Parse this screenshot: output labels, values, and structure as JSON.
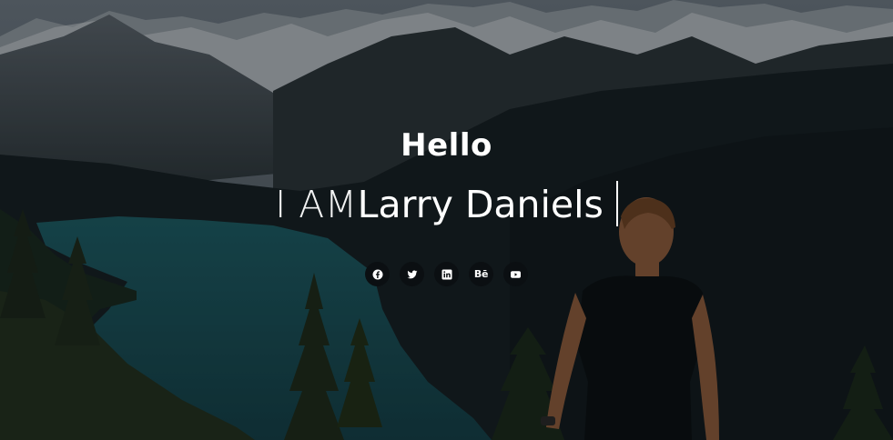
{
  "hero": {
    "greeting": "Hello",
    "prefix": "I AM",
    "name": "Larry Daniels",
    "overlay_color": "#000000",
    "text_color": "#ffffff",
    "social_button_color": "#0b0f12"
  },
  "social_links": [
    {
      "icon": "facebook-icon"
    },
    {
      "icon": "twitter-icon"
    },
    {
      "icon": "linkedin-icon"
    },
    {
      "icon": "behance-icon",
      "label": "Bē"
    },
    {
      "icon": "youtube-icon"
    }
  ]
}
